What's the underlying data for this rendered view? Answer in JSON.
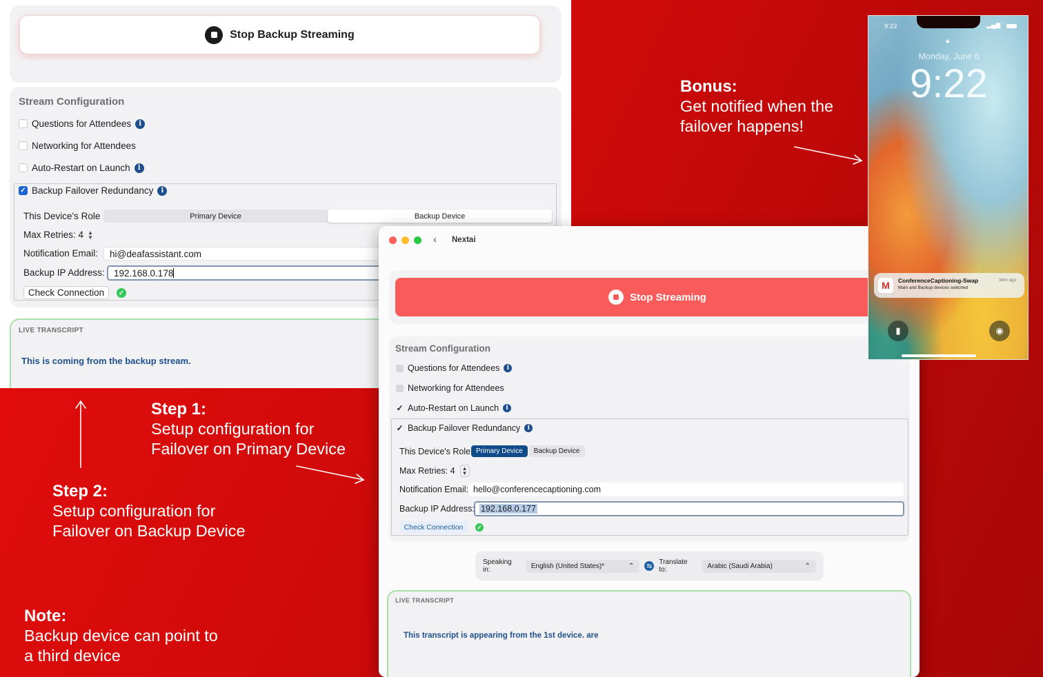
{
  "backup_window": {
    "stop_label": "Stop Backup Streaming",
    "config_title": "Stream Configuration",
    "options": [
      {
        "label": "Questions for Attendees",
        "checked": false
      },
      {
        "label": "Networking for Attendees",
        "checked": false
      },
      {
        "label": "Auto-Restart on Launch",
        "checked": false
      },
      {
        "label": "Backup Failover Redundancy",
        "checked": true
      }
    ],
    "role_label": "This Device's Role",
    "role_options": [
      "Primary Device",
      "Backup Device"
    ],
    "role_selected": "Backup Device",
    "retries_label": "Max Retries: 4",
    "email_label": "Notification Email:",
    "email_value": "hi@deafassistant.com",
    "ip_label": "Backup IP Address:",
    "ip_value": "192.168.0.178",
    "check_label": "Check Connection",
    "live_label": "LIVE TRANSCRIPT",
    "live_text": "This is coming from the backup stream.",
    "check_status": "ok"
  },
  "primary_window": {
    "app_title": "Nextai",
    "stop_label": "Stop Streaming",
    "config_title": "Stream Configuration",
    "options": [
      {
        "label": "Questions for Attendees",
        "checked": false
      },
      {
        "label": "Networking for Attendees",
        "checked": false
      },
      {
        "label": "Auto-Restart on Launch",
        "checked": true
      },
      {
        "label": "Backup Failover Redundancy",
        "checked": true
      }
    ],
    "role_label": "This Device's Role",
    "role_options": [
      "Primary Device",
      "Backup Device"
    ],
    "role_selected": "Primary Device",
    "retries_label": "Max Retries: 4",
    "email_label": "Notification Email:",
    "email_value": "hello@conferencecaptioning.com",
    "ip_label": "Backup IP Address:",
    "ip_value": "192.168.0.177",
    "check_label": "Check Connection",
    "speaking_label": "Speaking in:",
    "speaking_value": "English (United States)*",
    "translate_label": "Translate to:",
    "translate_value": "Arabic (Saudi Arabia)",
    "live_label": "LIVE TRANSCRIPT",
    "live_text": "This transcript is appearing from the 1st device. are"
  },
  "phone": {
    "status_time": "9:22",
    "date": "Monday, June 6",
    "clock": "9:22",
    "notification": {
      "app": "ConferenceCaptioning-Swap",
      "body": "Main and Backup devices switched",
      "time": "34m ago"
    }
  },
  "annotations": {
    "bonus_title": "Bonus:",
    "bonus_text_1": "Get notified when the",
    "bonus_text_2": "failover happens!",
    "step1_title": "Step 1:",
    "step1_text_1": "Setup configuration for",
    "step1_text_2": "Failover on Primary Device",
    "step2_title": "Step 2:",
    "step2_text_1": "Setup configuration for",
    "step2_text_2": "Failover on Backup Device",
    "note_title": "Note:",
    "note_text_1": "Backup device can point to",
    "note_text_2": "a third device"
  },
  "colors": {
    "background": "#d20a0a",
    "stop_streaming": "#f95b5b",
    "accent_blue": "#1e4f8c",
    "success_green": "#34c759"
  }
}
